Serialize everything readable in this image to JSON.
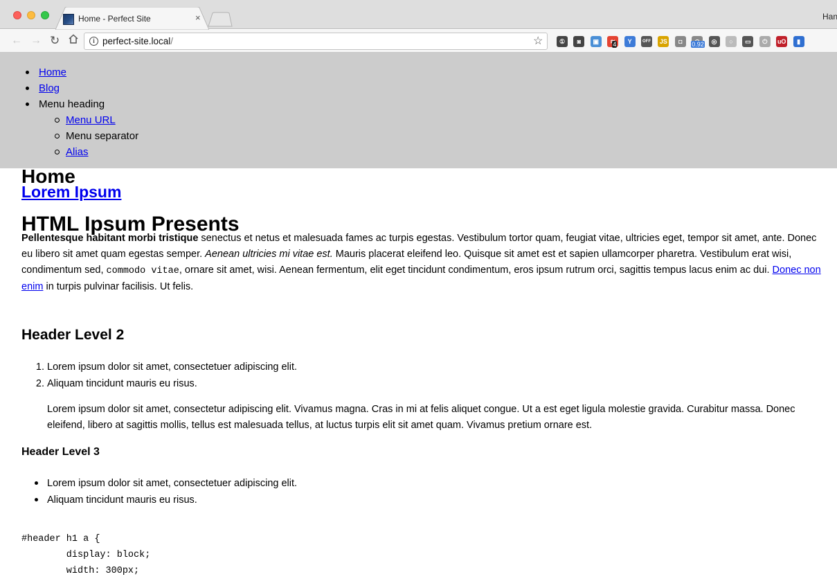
{
  "browser": {
    "tab_title": "Home - Perfect Site",
    "tab_close": "×",
    "profile_name": "Han",
    "url_host": "perfect-site.local",
    "url_path": "/",
    "extensions": [
      {
        "name": "onepassword",
        "glyph": "①",
        "color": "#444444"
      },
      {
        "name": "pocket",
        "glyph": "◙",
        "color": "#444444"
      },
      {
        "name": "window",
        "glyph": "▣",
        "color": "#4a8fd6"
      },
      {
        "name": "todoist",
        "glyph": "≋",
        "color": "#e44332",
        "badge": "4"
      },
      {
        "name": "y",
        "glyph": "Y",
        "color": "#3d7bd8"
      },
      {
        "name": "off",
        "glyph": "OFF",
        "color": "#555555"
      },
      {
        "name": "js",
        "glyph": "JS",
        "color": "#d9a400"
      },
      {
        "name": "camera",
        "glyph": "◘",
        "color": "#888888"
      },
      {
        "name": "speed",
        "glyph": "◠",
        "color": "#888888",
        "badge": "0.92"
      },
      {
        "name": "sync",
        "glyph": "◎",
        "color": "#555555"
      },
      {
        "name": "cloud",
        "glyph": "○",
        "color": "#bbbbbb"
      },
      {
        "name": "cast",
        "glyph": "▭",
        "color": "#555555"
      },
      {
        "name": "power",
        "glyph": "⏻",
        "color": "#aaaaaa"
      },
      {
        "name": "ublock",
        "glyph": "uO",
        "color": "#c0202a"
      },
      {
        "name": "meter",
        "glyph": "▮",
        "color": "#2f6fd1"
      }
    ]
  },
  "menu": {
    "home": "Home",
    "blog": "Blog",
    "heading": "Menu heading",
    "sub_url": "Menu URL",
    "sub_separator": "Menu separator",
    "sub_alias": "Alias"
  },
  "page": {
    "title": "Home",
    "site_name": "Lorem Ipsum",
    "article_title": "HTML Ipsum Presents",
    "intro_bold": "Pellentesque habitant morbi tristique",
    "intro_1": " senectus et netus et malesuada fames ac turpis egestas. Vestibulum tortor quam, feugiat vitae, ultricies eget, tempor sit amet, ante. Donec eu libero sit amet quam egestas semper. ",
    "intro_em": "Aenean ultricies mi vitae est.",
    "intro_2": " Mauris placerat eleifend leo. Quisque sit amet est et sapien ullamcorper pharetra. Vestibulum erat wisi, condimentum sed, ",
    "intro_code": "commodo vitae",
    "intro_3": ", ornare sit amet, wisi. Aenean fermentum, elit eget tincidunt condimentum, eros ipsum rutrum orci, sagittis tempus lacus enim ac dui. ",
    "intro_link": "Donec non enim",
    "intro_4": " in turpis pulvinar facilisis. Ut felis.",
    "h2": "Header Level 2",
    "ol": [
      "Lorem ipsum dolor sit amet, consectetuer adipiscing elit.",
      "Aliquam tincidunt mauris eu risus."
    ],
    "blockquote": "Lorem ipsum dolor sit amet, consectetur adipiscing elit. Vivamus magna. Cras in mi at felis aliquet congue. Ut a est eget ligula molestie gravida. Curabitur massa. Donec eleifend, libero at sagittis mollis, tellus est malesuada tellus, at luctus turpis elit sit amet quam. Vivamus pretium ornare est.",
    "h3": "Header Level 3",
    "ul": [
      "Lorem ipsum dolor sit amet, consectetuer adipiscing elit.",
      "Aliquam tincidunt mauris eu risus."
    ],
    "code_lines": [
      "#header h1 a {",
      "        display: block;",
      "        width: 300px;"
    ]
  }
}
